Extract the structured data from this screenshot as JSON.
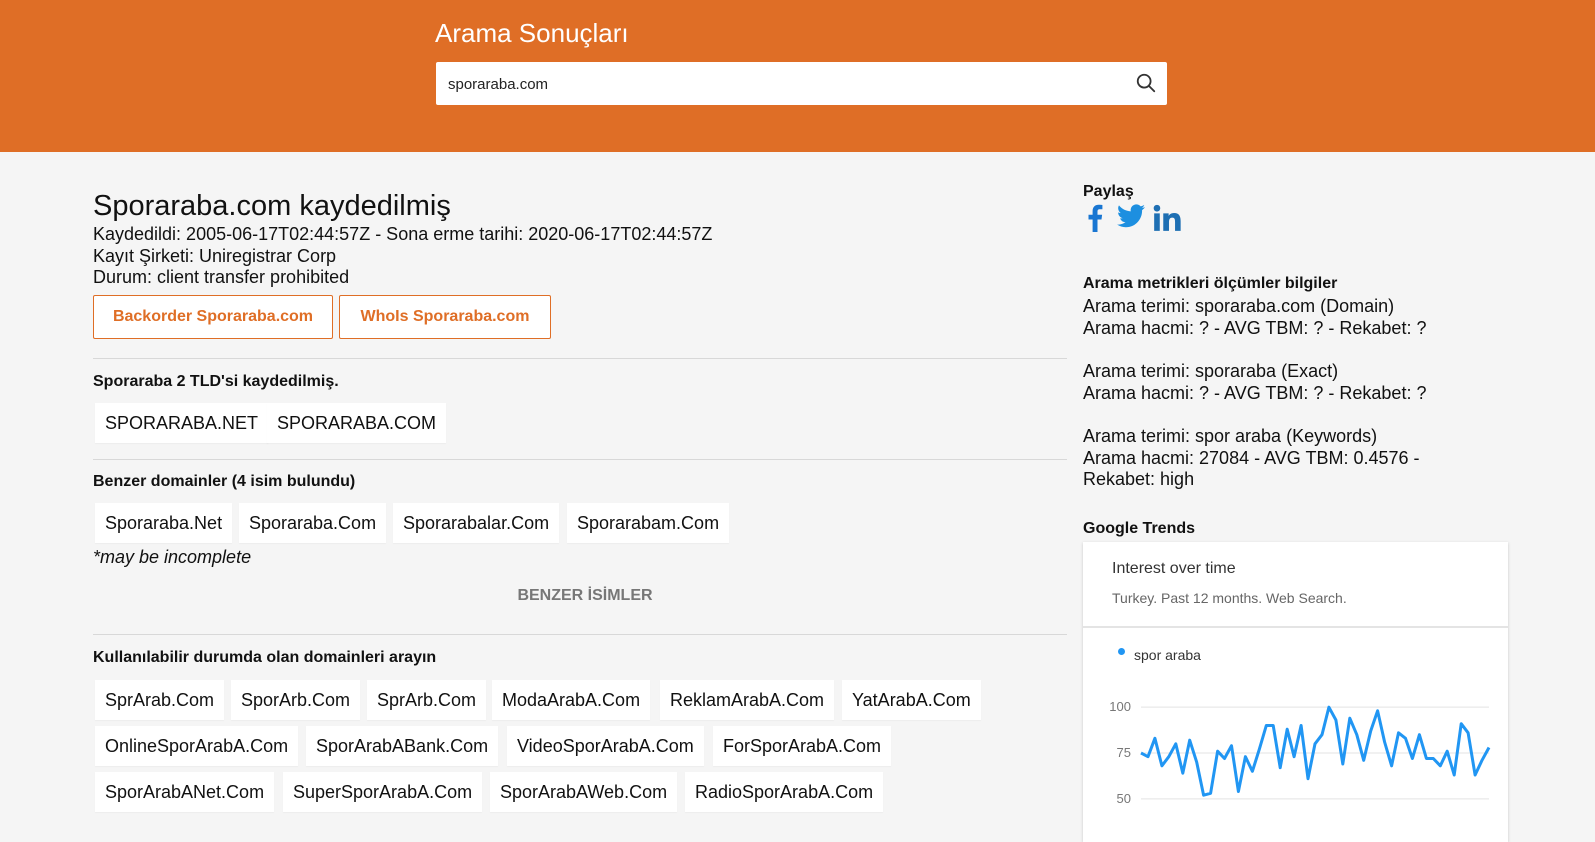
{
  "header": {
    "title": "Arama Sonuçları",
    "search_value": "sporaraba.com"
  },
  "domain": {
    "title": "Sporaraba.com kaydedilmiş",
    "registered_line": "Kaydedildi: 2005-06-17T02:44:57Z - Sona erme tarihi: 2020-06-17T02:44:57Z",
    "registrar_line": "Kayıt Şirketi: Uniregistrar Corp",
    "status_line": "Durum: client transfer prohibited",
    "backorder_label": "Backorder Sporaraba.com",
    "whois_label": "WhoIs Sporaraba.com"
  },
  "tld_section": {
    "heading": "Sporaraba 2 TLD'si kaydedilmiş.",
    "items": [
      "SPORARABA.NET",
      "SPORARABA.COM"
    ]
  },
  "similar_section": {
    "heading": "Benzer domainler (4 isim bulundu)",
    "items": [
      "Sporaraba.Net",
      "Sporaraba.Com",
      "Sporarabalar.Com",
      "Sporarabam.Com"
    ],
    "note": "*may be incomplete",
    "more_label": "BENZER İSİMLER"
  },
  "available_section": {
    "heading": "Kullanılabilir durumda olan domainleri arayın",
    "rows": [
      [
        "SprArab.Com",
        "SporArb.Com",
        "SprArb.Com",
        "ModaArabA.Com",
        "ReklamArabA.Com",
        "YatArabA.Com"
      ],
      [
        "OnlineSporArabA.Com",
        "SporArabABank.Com",
        "VideoSporArabA.Com",
        "ForSporArabA.Com"
      ],
      [
        "SporArabANet.Com",
        "SuperSporArabA.Com",
        "SporArabAWeb.Com",
        "RadioSporArabA.Com"
      ]
    ]
  },
  "sidebar": {
    "share_heading": "Paylaş",
    "share_icons": [
      "facebook-icon",
      "twitter-icon",
      "linkedin-icon"
    ],
    "metrics_heading": "Arama metrikleri ölçümler bilgiler",
    "metrics": [
      {
        "term": "Arama terimi: sporaraba.com (Domain)",
        "volume": "Arama hacmi: ? - AVG TBM: ? - Rekabet: ?"
      },
      {
        "term": "Arama terimi: sporaraba (Exact)",
        "volume": "Arama hacmi: ? - AVG TBM: ? - Rekabet: ?"
      },
      {
        "term": "Arama terimi: spor araba (Keywords)",
        "volume": "Arama hacmi: 27084 - AVG TBM: 0.4576 -",
        "volume_cont": "Rekabet: high"
      }
    ],
    "trends_heading": "Google Trends"
  },
  "trends": {
    "title": "Interest over time",
    "subtitle": "Turkey. Past 12 months. Web Search.",
    "legend": "spor araba"
  },
  "colors": {
    "brand": "#df6e26",
    "line": "#2196f3",
    "facebook": "#3b5998",
    "twitter": "#1da1f2",
    "linkedin": "#0077b5"
  },
  "chart_data": {
    "type": "line",
    "series": [
      {
        "name": "spor araba",
        "values": [
          75,
          73,
          83,
          68,
          73,
          80,
          64,
          82,
          70,
          52,
          53,
          76,
          72,
          79,
          54,
          73,
          65,
          77,
          90,
          90,
          67,
          88,
          73,
          90,
          61,
          80,
          85,
          100,
          93,
          69,
          94,
          85,
          71,
          87,
          98,
          81,
          68,
          86,
          83,
          72,
          85,
          72,
          72,
          68,
          76,
          63,
          91,
          86,
          63,
          71,
          78
        ]
      }
    ],
    "yticks": [
      100,
      75,
      50
    ],
    "ylim": [
      45,
      105
    ],
    "grid": true
  }
}
